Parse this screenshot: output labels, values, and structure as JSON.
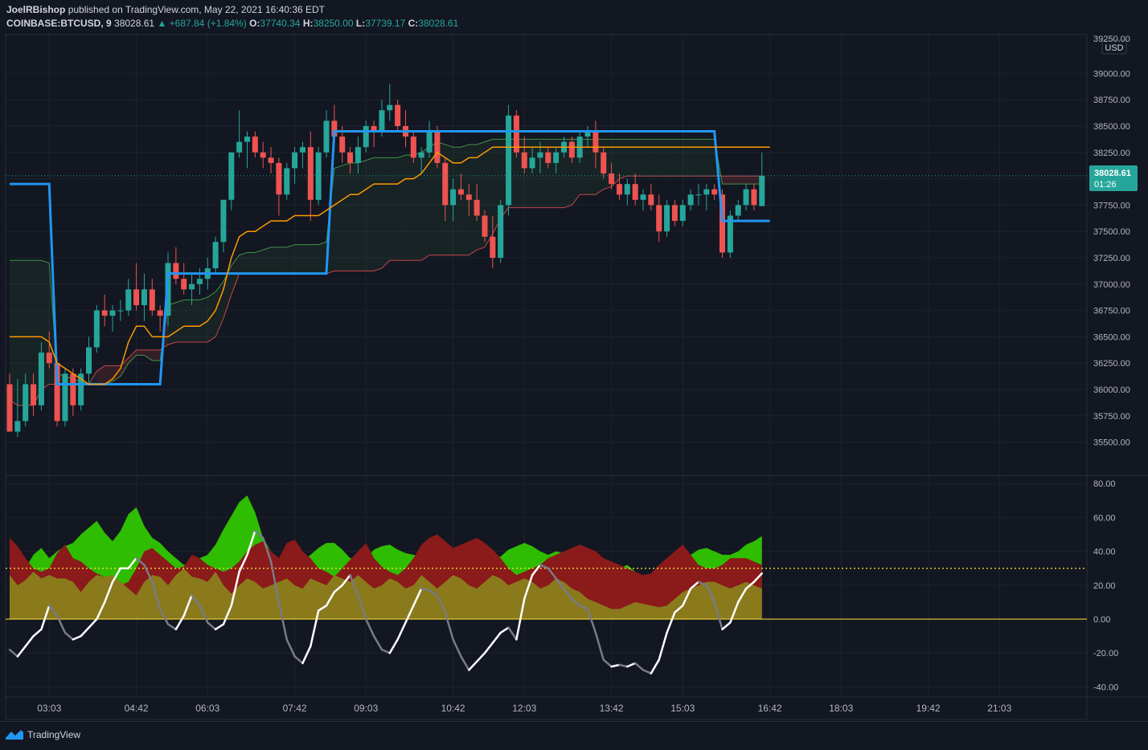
{
  "header": {
    "author": "JoelRBishop",
    "published_text": "published on TradingView.com, May 22, 2021 16:40:36 EDT",
    "symbol": "COINBASE:BTCUSD, 9",
    "last": "38028.61",
    "change": "▲ +687.84 (+1.84%)",
    "o_label": "O:",
    "o_value": "37740.34",
    "h_label": "H:",
    "h_value": "38250.00",
    "l_label": "L:",
    "l_value": "37739.17",
    "c_label": "C:",
    "c_value": "38028.61"
  },
  "price_axis": {
    "currency": "USD",
    "current_price": "38028.61",
    "countdown": "01:26",
    "top_label": "39250.00"
  },
  "footer": {
    "brand": "TradingView"
  },
  "colors": {
    "background": "#131722",
    "up": "#26a69a",
    "down": "#ef5350",
    "tenkan": "#2196f3",
    "kijun": "#ff9800",
    "senkou_a": "#4caf50",
    "senkou_b": "#ef5350",
    "osc_bull": "#2ebd00",
    "osc_bear": "#8b1a1a",
    "osc_base": "#8a7a1c",
    "signal_line": "#ffffff",
    "level_line": "#ffeb3b"
  },
  "chart_data": [
    {
      "type": "candlestick",
      "name": "price",
      "xlabels": [
        "03:03",
        "04:42",
        "06:03",
        "07:42",
        "09:03",
        "10:42",
        "12:03",
        "13:42",
        "15:03",
        "16:42",
        "18:03",
        "19:42",
        "21:03"
      ],
      "xlabel_index": [
        5,
        16,
        25,
        36,
        45,
        56,
        65,
        76,
        85,
        96,
        105,
        116,
        125
      ],
      "yticks": [
        39000,
        38750,
        38500,
        38250,
        38000,
        37750,
        37500,
        37250,
        37000,
        36750,
        36500,
        36250,
        36000,
        35750,
        35500
      ],
      "ylim": [
        35200,
        39300
      ],
      "candles": [
        [
          36050,
          36150,
          35650,
          35600
        ],
        [
          35600,
          36100,
          35550,
          35700
        ],
        [
          35700,
          36150,
          35650,
          36050
        ],
        [
          36050,
          36150,
          35750,
          35850
        ],
        [
          35850,
          36450,
          35800,
          36350
        ],
        [
          36350,
          36550,
          36200,
          36250
        ],
        [
          36250,
          36300,
          35650,
          35700
        ],
        [
          35700,
          36200,
          35650,
          36150
        ],
        [
          36150,
          36200,
          35750,
          35850
        ],
        [
          35850,
          36200,
          35800,
          36150
        ],
        [
          36150,
          36500,
          36050,
          36400
        ],
        [
          36400,
          36800,
          36350,
          36750
        ],
        [
          36750,
          36900,
          36600,
          36700
        ],
        [
          36700,
          36800,
          36550,
          36750
        ],
        [
          36750,
          36850,
          36650,
          36750
        ],
        [
          36750,
          37050,
          36700,
          36950
        ],
        [
          36950,
          37200,
          36750,
          36800
        ],
        [
          36800,
          37100,
          36650,
          36950
        ],
        [
          36950,
          37050,
          36700,
          36750
        ],
        [
          36750,
          36800,
          36550,
          36700
        ],
        [
          36700,
          37300,
          36600,
          37200
        ],
        [
          37200,
          37350,
          37000,
          37050
        ],
        [
          37050,
          37200,
          36900,
          36950
        ],
        [
          36950,
          37100,
          36800,
          37000
        ],
        [
          37000,
          37150,
          36900,
          37050
        ],
        [
          37050,
          37250,
          36950,
          37150
        ],
        [
          37150,
          37450,
          37100,
          37400
        ],
        [
          37400,
          37800,
          37300,
          37800
        ],
        [
          37800,
          38250,
          37700,
          38250
        ],
        [
          38250,
          38650,
          38200,
          38350
        ],
        [
          38350,
          38450,
          38100,
          38400
        ],
        [
          38400,
          38450,
          38200,
          38250
        ],
        [
          38250,
          38350,
          38100,
          38200
        ],
        [
          38200,
          38300,
          38050,
          38150
        ],
        [
          38150,
          38200,
          37650,
          37850
        ],
        [
          37850,
          38150,
          37800,
          38100
        ],
        [
          38100,
          38300,
          37950,
          38250
        ],
        [
          38250,
          38350,
          38100,
          38300
        ],
        [
          38300,
          38450,
          37600,
          37800
        ],
        [
          37800,
          38300,
          37750,
          38250
        ],
        [
          38250,
          38650,
          38200,
          38550
        ],
        [
          38550,
          38700,
          38350,
          38400
        ],
        [
          38400,
          38500,
          38150,
          38250
        ],
        [
          38250,
          38300,
          38050,
          38150
        ],
        [
          38150,
          38400,
          38050,
          38300
        ],
        [
          38300,
          38550,
          38250,
          38500
        ],
        [
          38500,
          38550,
          38300,
          38450
        ],
        [
          38450,
          38750,
          38400,
          38650
        ],
        [
          38650,
          38900,
          38550,
          38700
        ],
        [
          38700,
          38750,
          38450,
          38500
        ],
        [
          38500,
          38650,
          38300,
          38400
        ],
        [
          38400,
          38450,
          38150,
          38200
        ],
        [
          38200,
          38300,
          38050,
          38250
        ],
        [
          38250,
          38550,
          38200,
          38450
        ],
        [
          38450,
          38500,
          38100,
          38150
        ],
        [
          38150,
          38200,
          37600,
          37750
        ],
        [
          37750,
          38000,
          37600,
          37900
        ],
        [
          37900,
          38050,
          37800,
          37850
        ],
        [
          37850,
          37950,
          37650,
          37800
        ],
        [
          37800,
          37950,
          37600,
          37650
        ],
        [
          37650,
          37700,
          37400,
          37450
        ],
        [
          37450,
          37650,
          37150,
          37250
        ],
        [
          37250,
          37800,
          37200,
          37750
        ],
        [
          37750,
          38700,
          37650,
          38600
        ],
        [
          38600,
          38650,
          38200,
          38250
        ],
        [
          38250,
          38400,
          38050,
          38100
        ],
        [
          38100,
          38300,
          38050,
          38200
        ],
        [
          38200,
          38350,
          38050,
          38250
        ],
        [
          38250,
          38300,
          38100,
          38150
        ],
        [
          38150,
          38300,
          38050,
          38250
        ],
        [
          38250,
          38400,
          38200,
          38350
        ],
        [
          38350,
          38400,
          38150,
          38200
        ],
        [
          38200,
          38450,
          38150,
          38400
        ],
        [
          38400,
          38500,
          38300,
          38450
        ],
        [
          38450,
          38550,
          38100,
          38250
        ],
        [
          38250,
          38300,
          38000,
          38050
        ],
        [
          38050,
          38150,
          37900,
          37950
        ],
        [
          37950,
          38050,
          37800,
          37850
        ],
        [
          37850,
          38000,
          37750,
          37950
        ],
        [
          37950,
          38050,
          37750,
          37800
        ],
        [
          37800,
          37900,
          37700,
          37850
        ],
        [
          37850,
          37950,
          37700,
          37750
        ],
        [
          37750,
          37850,
          37400,
          37500
        ],
        [
          37500,
          37800,
          37450,
          37750
        ],
        [
          37750,
          37800,
          37550,
          37600
        ],
        [
          37600,
          37800,
          37550,
          37750
        ],
        [
          37750,
          37900,
          37700,
          37850
        ],
        [
          37850,
          37950,
          37750,
          37850
        ],
        [
          37850,
          37950,
          37700,
          37900
        ],
        [
          37900,
          37950,
          37800,
          37850
        ],
        [
          37850,
          37900,
          37250,
          37300
        ],
        [
          37300,
          37700,
          37250,
          37650
        ],
        [
          37650,
          37800,
          37600,
          37750
        ],
        [
          37750,
          37950,
          37700,
          37900
        ],
        [
          37900,
          37950,
          37700,
          37750
        ],
        [
          37740.34,
          38250,
          37739.17,
          38028.61
        ]
      ],
      "tenkan": [
        37950,
        37950,
        37950,
        37950,
        37950,
        37950,
        36050,
        36050,
        36050,
        36050,
        36050,
        36050,
        36050,
        36050,
        36050,
        36050,
        36050,
        36050,
        36050,
        36050,
        37100,
        37100,
        37100,
        37100,
        37100,
        37100,
        37100,
        37100,
        37100,
        37100,
        37100,
        37100,
        37100,
        37100,
        37100,
        37100,
        37100,
        37100,
        37100,
        37100,
        37100,
        38450,
        38450,
        38450,
        38450,
        38450,
        38450,
        38450,
        38450,
        38450,
        38450,
        38450,
        38450,
        38450,
        38450,
        38450,
        38450,
        38450,
        38450,
        38450,
        38450,
        38450,
        38450,
        38450,
        38450,
        38450,
        38450,
        38450,
        38450,
        38450,
        38450,
        38450,
        38450,
        38450,
        38450,
        38450,
        38450,
        38450,
        38450,
        38450,
        38450,
        38450,
        38450,
        38450,
        38450,
        38450,
        38450,
        38450,
        38450,
        38450,
        37600,
        37600,
        37600,
        37600,
        37600,
        37600,
        37600
      ],
      "kijun": [
        36500,
        36500,
        36500,
        36500,
        36500,
        36450,
        36250,
        36200,
        36150,
        36100,
        36050,
        36050,
        36050,
        36100,
        36200,
        36450,
        36600,
        36600,
        36500,
        36500,
        36500,
        36550,
        36600,
        36600,
        36600,
        36650,
        36750,
        36950,
        37250,
        37450,
        37500,
        37500,
        37550,
        37600,
        37600,
        37600,
        37650,
        37650,
        37650,
        37650,
        37700,
        37750,
        37800,
        37850,
        37850,
        37900,
        37950,
        37950,
        37950,
        37950,
        38000,
        38000,
        38050,
        38150,
        38250,
        38200,
        38150,
        38150,
        38200,
        38200,
        38250,
        38300,
        38300,
        38300,
        38300,
        38300,
        38300,
        38300,
        38300,
        38300,
        38300,
        38300,
        38300,
        38300,
        38300,
        38300,
        38300,
        38300,
        38300,
        38300,
        38300,
        38300,
        38300,
        38300,
        38300,
        38300,
        38300,
        38300,
        38300,
        38300,
        38300,
        38300,
        38300,
        38300,
        38300,
        38300,
        38300
      ]
    },
    {
      "type": "area",
      "name": "oscillator",
      "yticks": [
        80,
        60,
        40,
        20,
        0,
        -20,
        -40
      ],
      "ylim": [
        -45,
        82
      ],
      "level": 30,
      "zero": 0,
      "bull": [
        40,
        35,
        30,
        38,
        42,
        36,
        40,
        43,
        45,
        50,
        54,
        58,
        51,
        46,
        52,
        62,
        66,
        55,
        48,
        45,
        40,
        36,
        32,
        32,
        36,
        38,
        44,
        53,
        61,
        69,
        73,
        63,
        48,
        40,
        36,
        35,
        33,
        34,
        38,
        42,
        45,
        45,
        41,
        36,
        36,
        36,
        41,
        43,
        44,
        41,
        39,
        38,
        37,
        34,
        33,
        32,
        31,
        33,
        36,
        39,
        38,
        36,
        37,
        41,
        43,
        45,
        43,
        40,
        38,
        40,
        39,
        36,
        34,
        31,
        30,
        32,
        30,
        30,
        32,
        28,
        25,
        24,
        26,
        28,
        33,
        36,
        38,
        41,
        42,
        40,
        38,
        38,
        40,
        44,
        46,
        49
      ],
      "bear": [
        48,
        43,
        36,
        30,
        28,
        30,
        39,
        44,
        36,
        34,
        30,
        27,
        25,
        22,
        20,
        22,
        30,
        40,
        42,
        38,
        34,
        30,
        31,
        38,
        36,
        32,
        30,
        28,
        30,
        34,
        40,
        44,
        46,
        40,
        36,
        45,
        47,
        40,
        36,
        30,
        28,
        25,
        30,
        35,
        40,
        45,
        36,
        31,
        28,
        26,
        30,
        36,
        44,
        48,
        50,
        46,
        42,
        44,
        46,
        48,
        45,
        41,
        36,
        30,
        26,
        28,
        30,
        32,
        36,
        38,
        40,
        42,
        44,
        42,
        40,
        36,
        34,
        32,
        30,
        28,
        26,
        27,
        32,
        36,
        40,
        44,
        38,
        32,
        30,
        30,
        32,
        36,
        36,
        36,
        34,
        32
      ],
      "base": [
        26,
        20,
        23,
        28,
        24,
        26,
        24,
        24,
        22,
        16,
        22,
        26,
        25,
        26,
        22,
        18,
        14,
        22,
        26,
        25,
        20,
        26,
        30,
        25,
        24,
        22,
        28,
        20,
        15,
        20,
        24,
        22,
        18,
        20,
        22,
        24,
        20,
        18,
        24,
        22,
        20,
        26,
        24,
        22,
        26,
        22,
        18,
        20,
        24,
        22,
        18,
        20,
        26,
        22,
        18,
        22,
        26,
        24,
        20,
        18,
        22,
        26,
        24,
        20,
        22,
        24,
        22,
        18,
        20,
        24,
        22,
        18,
        16,
        12,
        10,
        8,
        6,
        6,
        8,
        10,
        9,
        8,
        7,
        8,
        12,
        16,
        18,
        20,
        22,
        22,
        20,
        18,
        20,
        22,
        20,
        18
      ],
      "signal": [
        -18,
        -22,
        -16,
        -10,
        -6,
        8,
        2,
        -8,
        -12,
        -10,
        -5,
        0,
        10,
        22,
        30,
        30,
        36,
        32,
        22,
        6,
        -3,
        -6,
        2,
        14,
        8,
        -2,
        -6,
        -3,
        8,
        28,
        38,
        52,
        48,
        34,
        10,
        -12,
        -22,
        -26,
        -16,
        5,
        8,
        16,
        20,
        26,
        14,
        0,
        -10,
        -18,
        -20,
        -12,
        -2,
        8,
        18,
        17,
        14,
        4,
        -12,
        -22,
        -30,
        -25,
        -20,
        -14,
        -8,
        -5,
        -12,
        12,
        26,
        32,
        30,
        24,
        18,
        12,
        8,
        6,
        -8,
        -24,
        -28,
        -27,
        -28,
        -26,
        -30,
        -32,
        -24,
        -8,
        4,
        8,
        18,
        22,
        20,
        10,
        -6,
        -2,
        10,
        18,
        22,
        27
      ]
    }
  ]
}
